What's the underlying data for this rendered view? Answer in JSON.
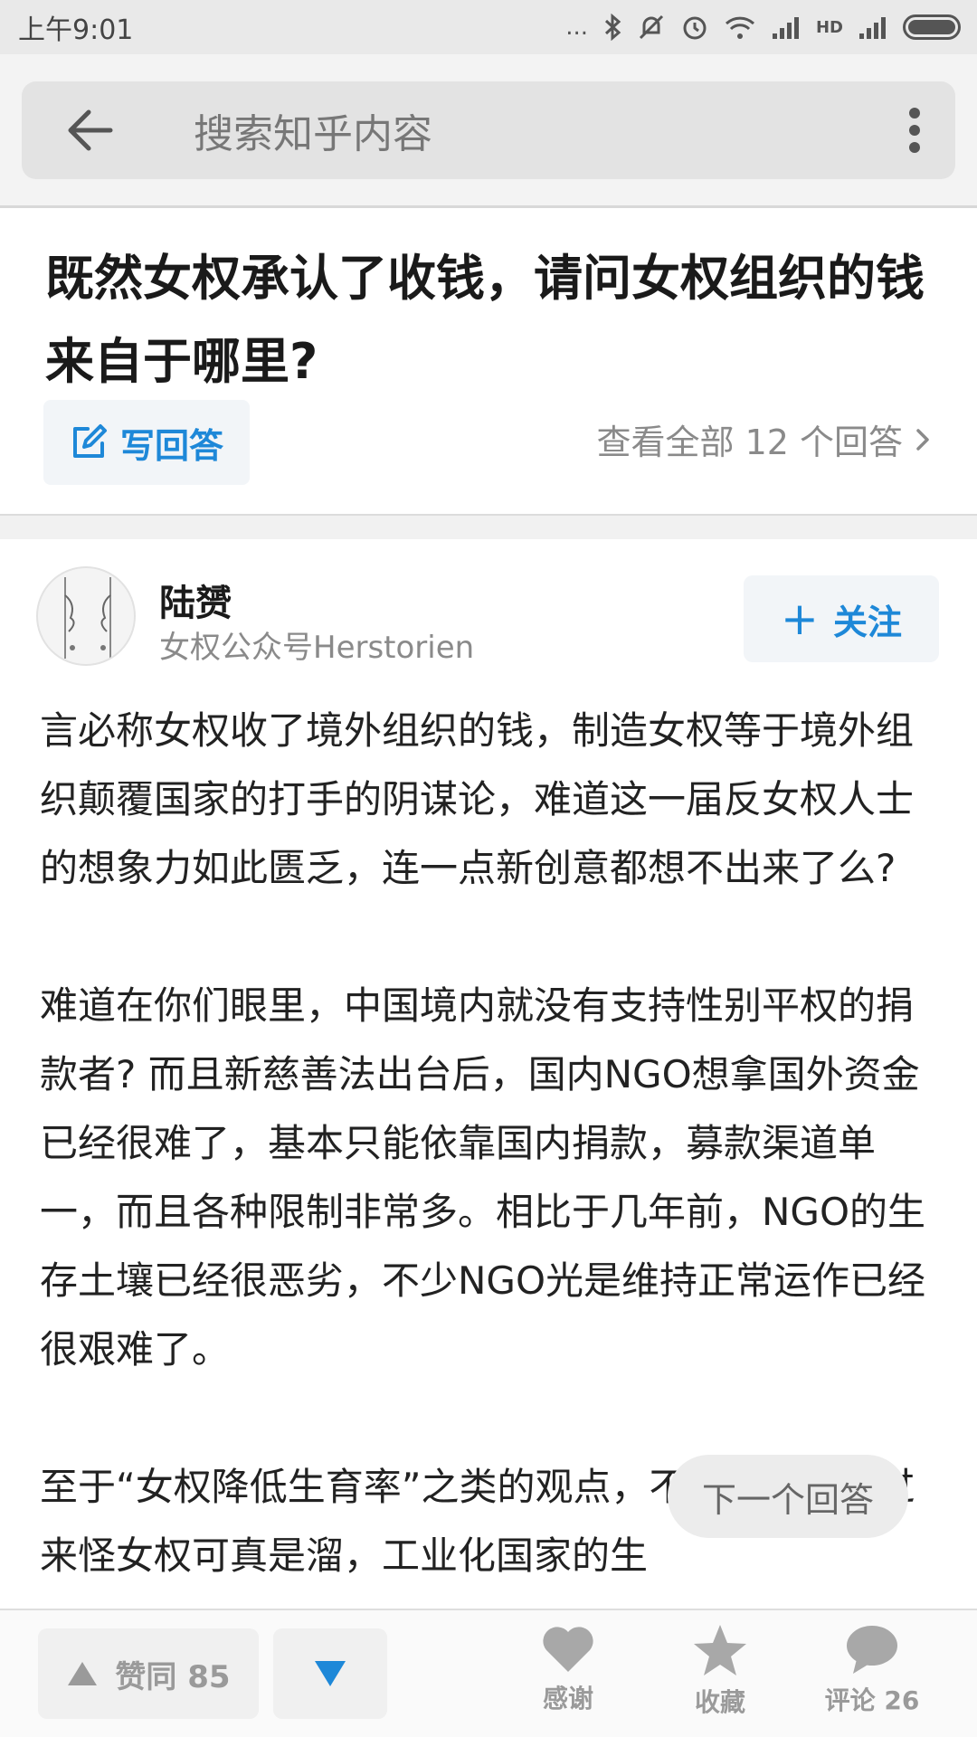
{
  "status_bar": {
    "time": "上午9:01",
    "dots": "...",
    "network_label": "HD"
  },
  "search": {
    "placeholder": "搜索知乎内容"
  },
  "question": {
    "title": "既然女权承认了收钱，请问女权组织的钱来自于哪里?",
    "write_answer_label": "写回答",
    "view_all_label": "查看全部 12 个回答"
  },
  "author": {
    "name": "陆赟",
    "bio": "女权公众号Herstorien",
    "follow_label": "关注"
  },
  "answer": {
    "paragraphs": [
      "言必称女权收了境外组织的钱，制造女权等于境外组织颠覆国家的打手的阴谋论，难道这一届反女权人士的想象力如此匮乏，连一点新创意都想不出来了么?",
      "难道在你们眼里，中国境内就没有支持性别平权的捐款者? 而且新慈善法出台后，国内NGO想拿国外资金已经很难了，基本只能依靠国内捐款，募款渠道单一，而且各种限制非常多。相比于几年前，NGO的生存土壤已经很恶劣，不少NGO光是维持正常运作已经很艰难了。",
      "至于“女权降低生育率”之类的观点，不愿生孩子反过来怪女权可真是溜，工业化国家的生"
    ]
  },
  "next_answer_label": "下一个回答",
  "bottom_bar": {
    "upvote_label": "赞同 85",
    "thanks_label": "感谢",
    "collect_label": "收藏",
    "comments_label": "评论 26"
  },
  "colors": {
    "accent": "#1e88d8",
    "muted": "#9a9a9a"
  }
}
